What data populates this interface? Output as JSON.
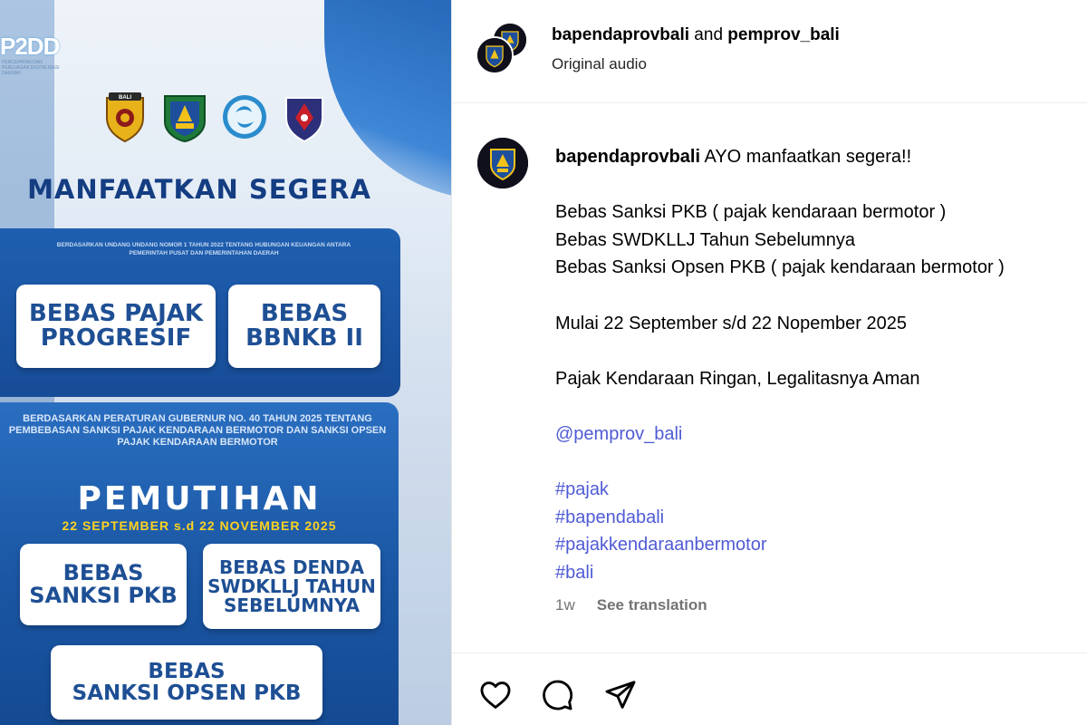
{
  "poster": {
    "brand_logo": "P2DD",
    "brand_sub": "PERCEPATAN DAN PERLUASAN DIGITALISASI DAERAH",
    "logo_top_label": "BALI",
    "headline": "MANFAATKAN SEGERA",
    "legal_basis_1": "BERDASARKAN UNDANG UNDANG NOMOR 1 TAHUN 2022 TENTANG HUBUNGAN KEUANGAN ANTARA PEMERINTAH PUSAT DAN PEMERINTAHAN DAERAH",
    "pill_1": "BEBAS PAJAK\nPROGRESIF",
    "pill_2": "BEBAS\nBBNKB II",
    "legal_basis_2": "BERDASARKAN PERATURAN GUBERNUR NO. 40 TAHUN 2025 TENTANG PEMBEBASAN SANKSI PAJAK KENDARAAN BERMOTOR DAN SANKSI OPSEN PAJAK KENDARAAN BERMOTOR",
    "program_title": "PEMUTIHAN",
    "program_dates": "22 SEPTEMBER s.d 22 NOVEMBER 2025",
    "pill_3": "BEBAS\nSANKSI PKB",
    "pill_4": "BEBAS DENDA\nSWDKLLJ TAHUN\nSEBELUMNYA",
    "pill_5": "BEBAS\nSANKSI OPSEN PKB"
  },
  "post": {
    "author_1": "bapendaprovbali",
    "author_joiner": " and ",
    "author_2": "pemprov_bali",
    "audio": "Original audio",
    "caption_username": "bapendaprovbali",
    "caption_lines": [
      "AYO manfaatkan segera!!",
      "",
      "Bebas Sanksi PKB ( pajak kendaraan bermotor )",
      "Bebas SWDKLLJ Tahun Sebelumnya",
      "Bebas Sanksi Opsen PKB ( pajak kendaraan bermotor )",
      "",
      "Mulai 22 September s/d 22 Nopember 2025",
      "",
      "Pajak Kendaraan Ringan, Legalitasnya Aman",
      "",
      "@pemprov_bali",
      "",
      "#pajak",
      "#bapendabali",
      "#pajakkendaraanbermotor",
      "#bali"
    ],
    "time_ago": "1w",
    "see_translation": "See translation",
    "icons": {
      "like": "heart-icon",
      "comment": "comment-icon",
      "share": "share-icon"
    },
    "colors": {
      "link": "#4f5bd5",
      "muted": "#737373",
      "poster_blue": "#1e4f94",
      "poster_yellow": "#ffd21f"
    }
  }
}
